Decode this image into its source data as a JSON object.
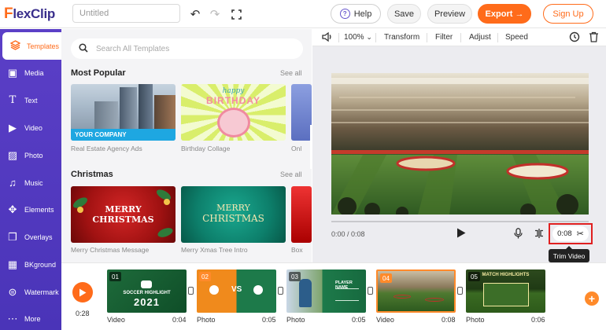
{
  "app": {
    "logo": {
      "mark": "F",
      "text": "lexClip"
    },
    "title_placeholder": "Untitled"
  },
  "topbar": {
    "help": "Help",
    "save": "Save",
    "preview": "Preview",
    "export": "Export →",
    "signup": "Sign Up"
  },
  "sidebar": {
    "items": [
      {
        "label": "Templates",
        "icon": "layers-icon",
        "active": true
      },
      {
        "label": "Media",
        "icon": "media-icon"
      },
      {
        "label": "Text",
        "icon": "text-icon"
      },
      {
        "label": "Video",
        "icon": "video-icon"
      },
      {
        "label": "Photo",
        "icon": "photo-icon"
      },
      {
        "label": "Music",
        "icon": "music-icon"
      },
      {
        "label": "Elements",
        "icon": "elements-icon"
      },
      {
        "label": "Overlays",
        "icon": "overlays-icon"
      },
      {
        "label": "BKground",
        "icon": "background-icon"
      },
      {
        "label": "Watermark",
        "icon": "watermark-icon"
      },
      {
        "label": "More",
        "icon": "more-icon"
      }
    ]
  },
  "templates": {
    "search_placeholder": "Search All Templates",
    "sections": [
      {
        "title": "Most Popular",
        "see_all": "See all",
        "items": [
          {
            "caption": "Real Estate Agency Ads",
            "banner": "YOUR COMPANY"
          },
          {
            "caption": "Birthday Collage",
            "line1": "happy",
            "line2": "BIRTHDAY"
          },
          {
            "caption": "Onl"
          }
        ]
      },
      {
        "title": "Christmas",
        "see_all": "See all",
        "items": [
          {
            "caption": "Merry Christmas Message",
            "line1": "MERRY",
            "line2": "CHRISTMAS"
          },
          {
            "caption": "Merry Xmas Tree Intro",
            "line1": "MERRY",
            "line2": "CHRISTMAS"
          },
          {
            "caption": "Box"
          }
        ]
      }
    ]
  },
  "preview": {
    "toolbar": {
      "zoom": "100%",
      "transform": "Transform",
      "filter": "Filter",
      "adjust": "Adjust",
      "speed": "Speed"
    },
    "timecode": "0:00 / 0:08",
    "trim_duration": "0:08",
    "trim_tooltip": "Trim Video"
  },
  "timeline": {
    "total": "0:28",
    "clips": [
      {
        "num": "01",
        "type": "Video",
        "duration": "0:04",
        "title": "SOCCER HIGHLIGHT",
        "year": "2021"
      },
      {
        "num": "02",
        "type": "Photo",
        "duration": "0:05",
        "vs": "VS"
      },
      {
        "num": "03",
        "type": "Photo",
        "duration": "0:05",
        "title": "PLAYER NAME"
      },
      {
        "num": "04",
        "type": "Video",
        "duration": "0:08",
        "selected": true
      },
      {
        "num": "05",
        "type": "Photo",
        "duration": "0:06",
        "title": "MATCH HIGHLIGHTS"
      }
    ]
  },
  "colors": {
    "brand_purple": "#5b3fc7",
    "accent_orange": "#ff6b1a",
    "highlight_red": "#e02020"
  }
}
